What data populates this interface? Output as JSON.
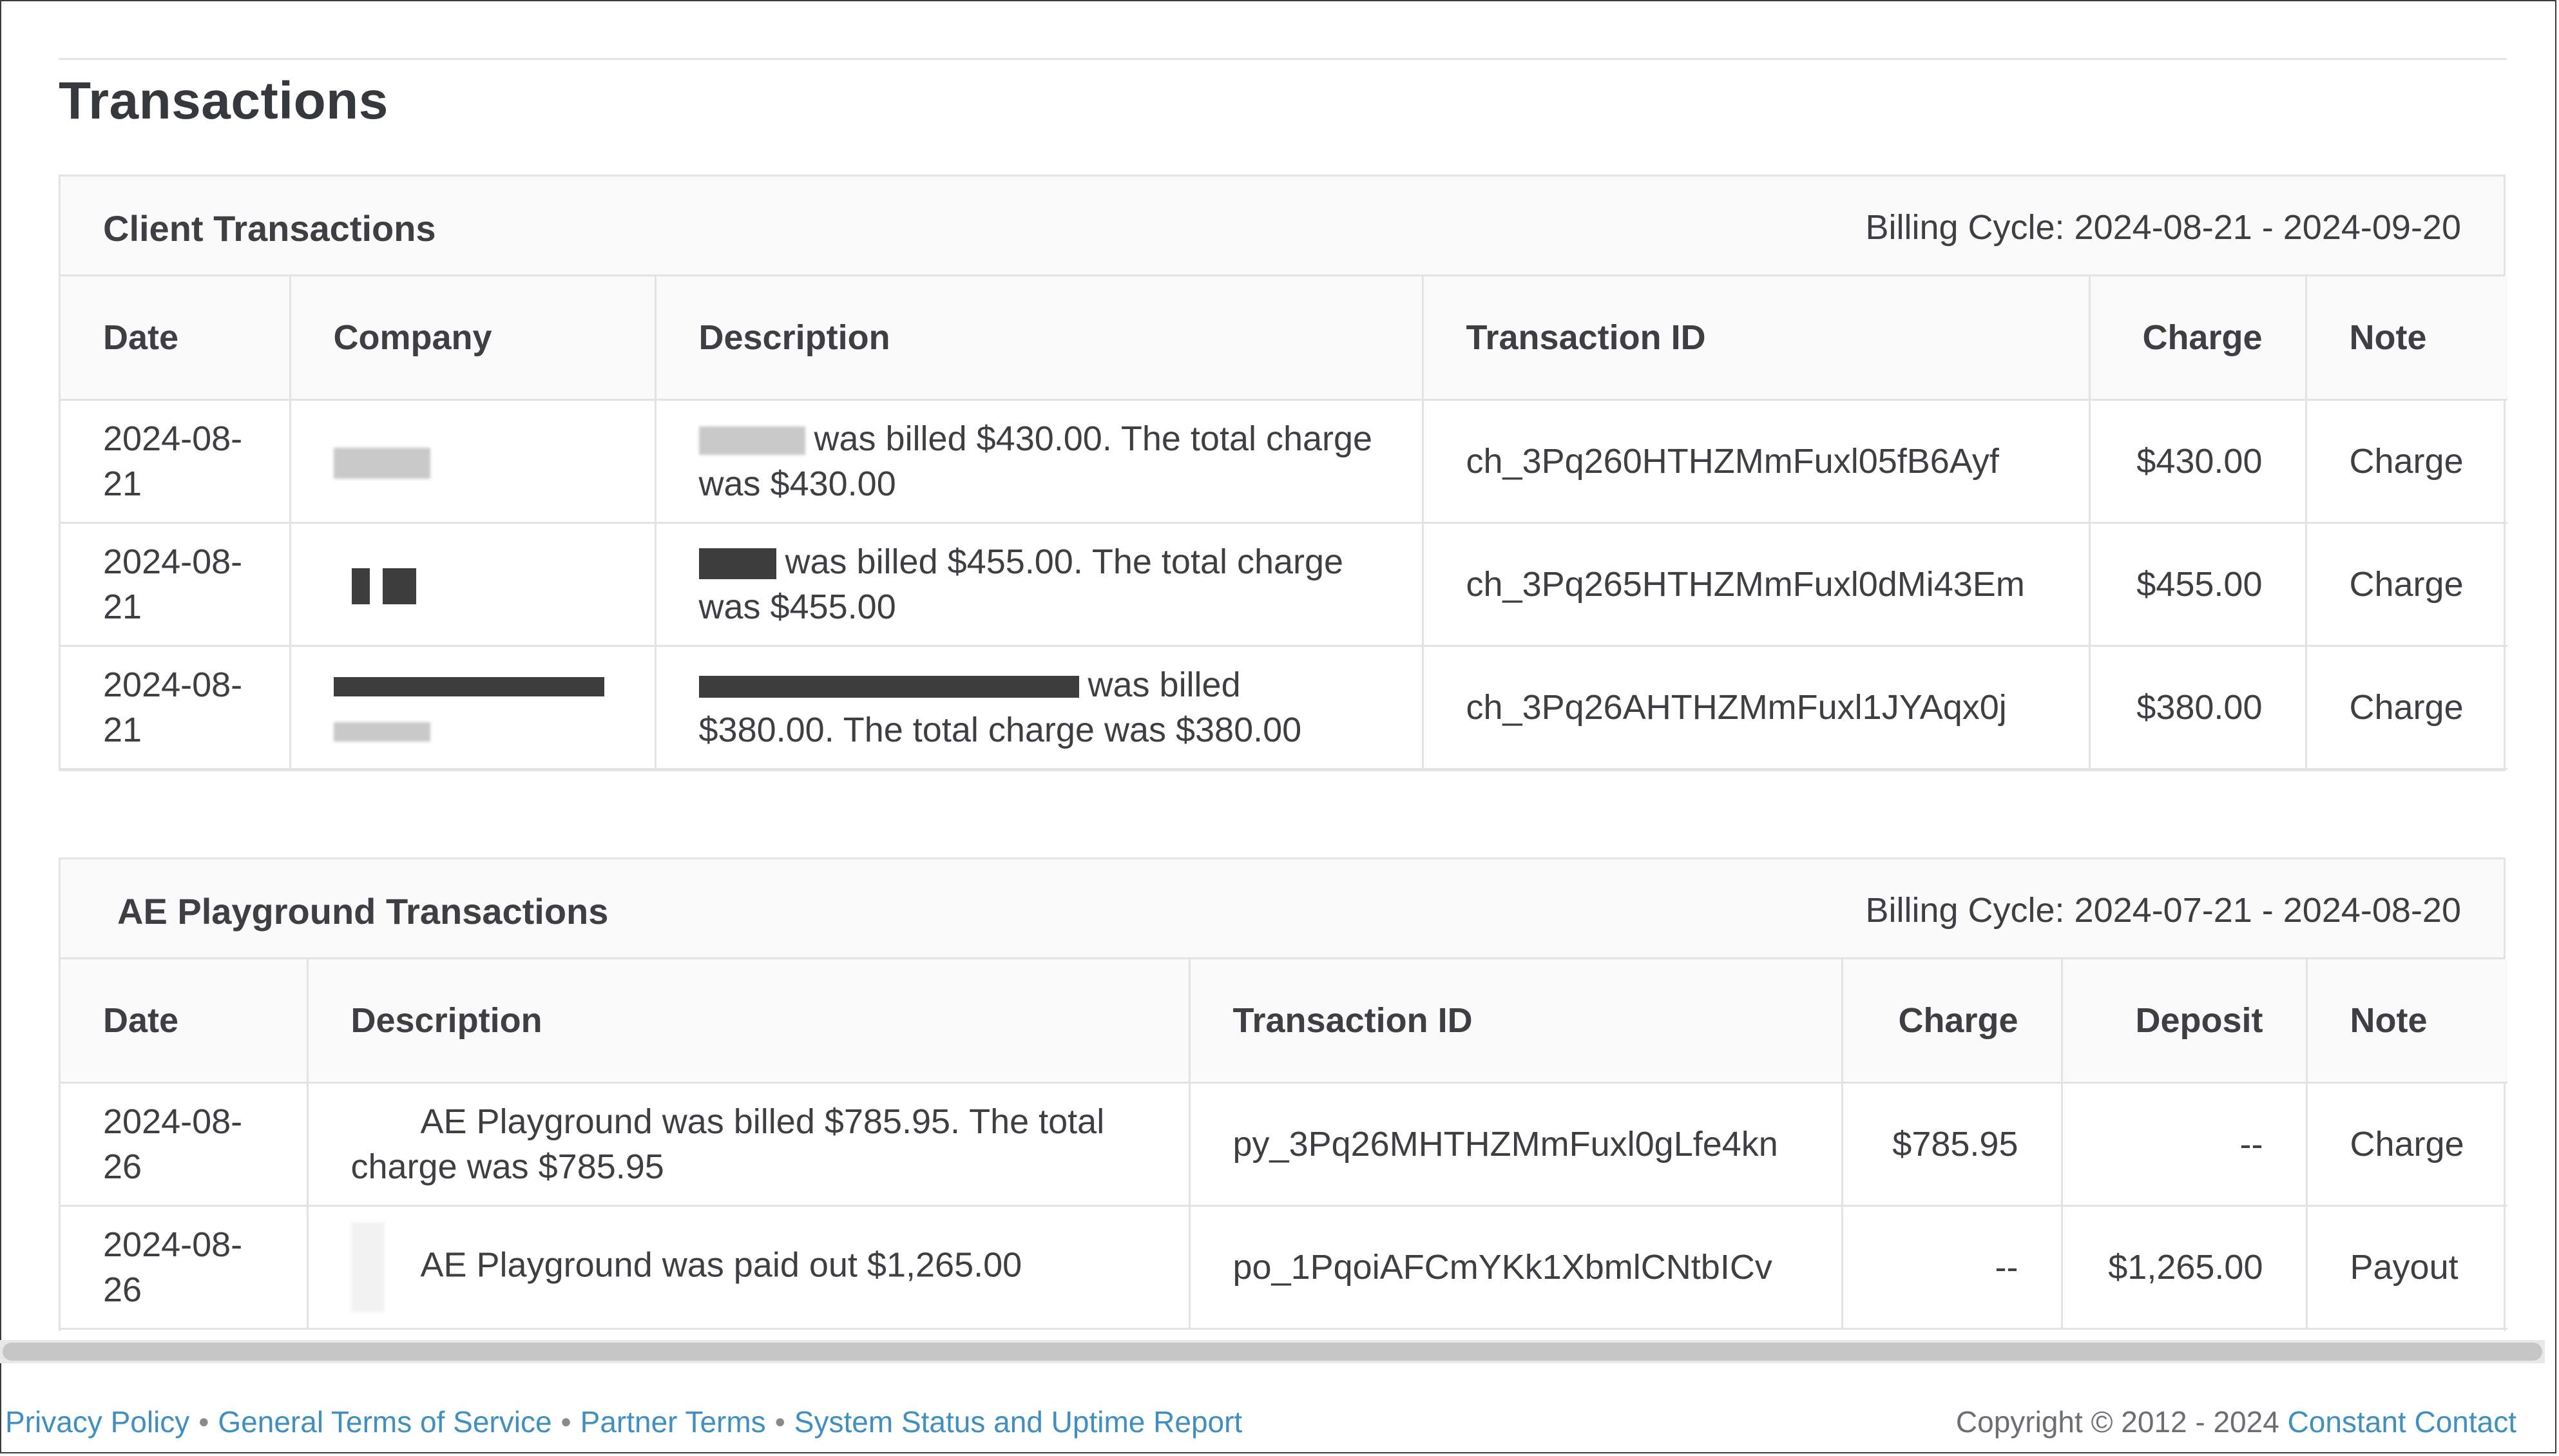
{
  "page_title": "Transactions",
  "client_transactions": {
    "title": "Client Transactions",
    "billing_cycle": "Billing Cycle: 2024-08-21 - 2024-09-20",
    "columns": [
      "Date",
      "Company",
      "Description",
      "Transaction ID",
      "Charge",
      "Note"
    ],
    "rows": [
      {
        "date": "2024-08-21",
        "description": "was billed $430.00. The total charge was $430.00",
        "transaction_id": "ch_3Pq260HTHZMmFuxl05fB6Ayf",
        "charge": "$430.00",
        "note": "Charge"
      },
      {
        "date": "2024-08-21",
        "description": "was billed $455.00. The total charge was $455.00",
        "transaction_id": "ch_3Pq265HTHZMmFuxl0dMi43Em",
        "charge": "$455.00",
        "note": "Charge"
      },
      {
        "date": "2024-08-21",
        "description": "was billed $380.00. The total charge was $380.00",
        "transaction_id": "ch_3Pq26AHTHZMmFuxl1JYAqx0j",
        "charge": "$380.00",
        "note": "Charge"
      }
    ]
  },
  "ae_transactions": {
    "title": "AE Playground Transactions",
    "billing_cycle": "Billing Cycle: 2024-07-21 - 2024-08-20",
    "columns": [
      "Date",
      "Description",
      "Transaction ID",
      "Charge",
      "Deposit",
      "Note"
    ],
    "rows": [
      {
        "date": "2024-08-26",
        "description": "AE Playground  was billed $785.95. The total charge was $785.95",
        "transaction_id": "py_3Pq26MHTHZMmFuxl0gLfe4kn",
        "charge": "$785.95",
        "deposit": "--",
        "note": "Charge"
      },
      {
        "date": "2024-08-26",
        "description": "AE Playground was paid out $1,265.00",
        "transaction_id": "po_1PqoiAFCmYKk1XbmlCNtbICv",
        "charge": "--",
        "deposit": "$1,265.00",
        "note": "Payout"
      }
    ]
  },
  "footer": {
    "links": [
      "Privacy Policy",
      "General Terms of Service",
      "Partner Terms",
      "System Status and Uptime Report"
    ],
    "separator": "•",
    "copyright_prefix": "Copyright © 2012 - 2024",
    "copyright_link": "Constant Contact"
  }
}
